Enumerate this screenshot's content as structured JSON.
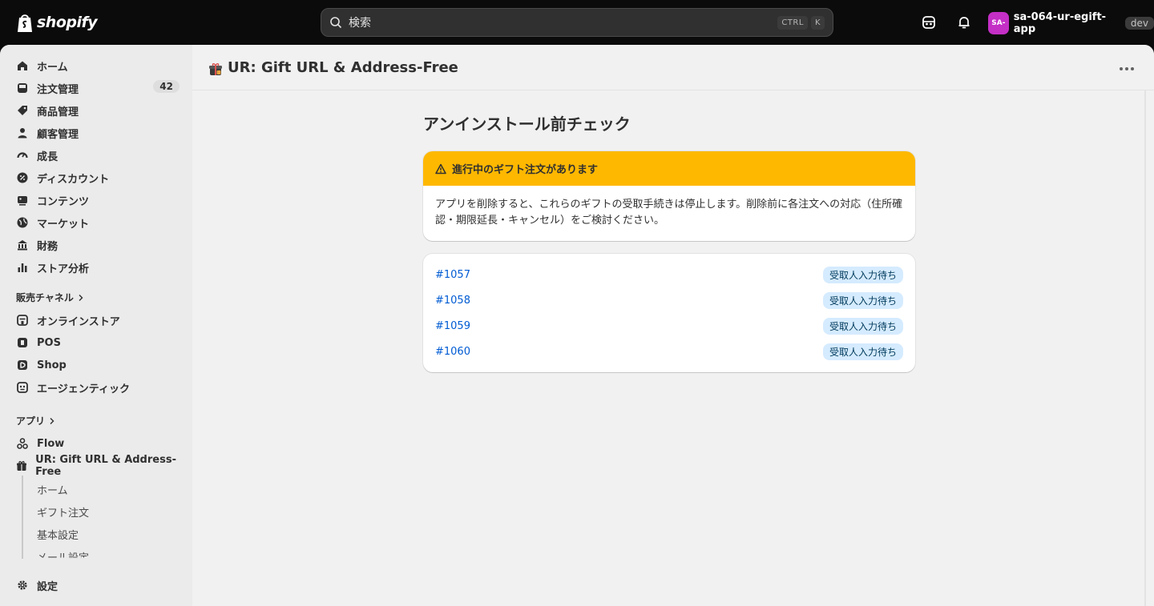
{
  "topbar": {
    "logo_text": "shopify",
    "search_placeholder": "検索",
    "shortcut_ctrl": "CTRL",
    "shortcut_key": "K",
    "icons": [
      "store-activity-icon",
      "bell-icon"
    ],
    "store_avatar": "SA-",
    "store_name": "sa-064-ur-egift-app",
    "store_badge": "dev"
  },
  "sidebar": {
    "main_items": [
      {
        "label": "ホーム",
        "icon": "home-icon"
      },
      {
        "label": "注文管理",
        "icon": "orders-icon",
        "count": "42"
      },
      {
        "label": "商品管理",
        "icon": "tag-icon"
      },
      {
        "label": "顧客管理",
        "icon": "person-icon"
      },
      {
        "label": "成長",
        "icon": "gauge-icon"
      },
      {
        "label": "ディスカウント",
        "icon": "discount-icon"
      },
      {
        "label": "コンテンツ",
        "icon": "content-icon"
      },
      {
        "label": "マーケット",
        "icon": "globe-icon"
      },
      {
        "label": "財務",
        "icon": "bank-icon"
      },
      {
        "label": "ストア分析",
        "icon": "bar-chart-icon"
      }
    ],
    "sales_channels_title": "販売チャネル",
    "sales_channels": [
      {
        "label": "オンラインストア",
        "icon": "online-store-icon"
      },
      {
        "label": "POS",
        "icon": "pos-icon"
      },
      {
        "label": "Shop",
        "icon": "shop-icon"
      },
      {
        "label": "エージェンティック",
        "icon": "agentic-icon"
      }
    ],
    "apps_title": "アプリ",
    "apps": [
      {
        "label": "Flow",
        "icon": "flow-icon"
      },
      {
        "label": "UR: Gift URL & Address-Free",
        "icon": "gift-icon"
      }
    ],
    "app_sub_items": [
      "ホーム",
      "ギフト注文",
      "基本設定",
      "メール設定"
    ],
    "settings_label": "設定"
  },
  "app_header": {
    "title": "UR: Gift URL & Address-Free"
  },
  "main": {
    "heading": "アンインストール前チェック",
    "banner": {
      "title": "進行中のギフト注文があります",
      "body": "アプリを削除すると、これらのギフトの受取手続きは停止します。削除前に各注文への対応（住所確認・期限延長・キャンセル）をご検討ください。"
    },
    "orders": [
      {
        "number": "#1057",
        "status": "受取人入力待ち"
      },
      {
        "number": "#1058",
        "status": "受取人入力待ち"
      },
      {
        "number": "#1059",
        "status": "受取人入力待ち"
      },
      {
        "number": "#1060",
        "status": "受取人入力待ち"
      }
    ]
  },
  "colors": {
    "warning": "#ffb800",
    "link": "#005bd3",
    "badge_bg": "#d5ebff",
    "avatar": "#c42fc6"
  }
}
